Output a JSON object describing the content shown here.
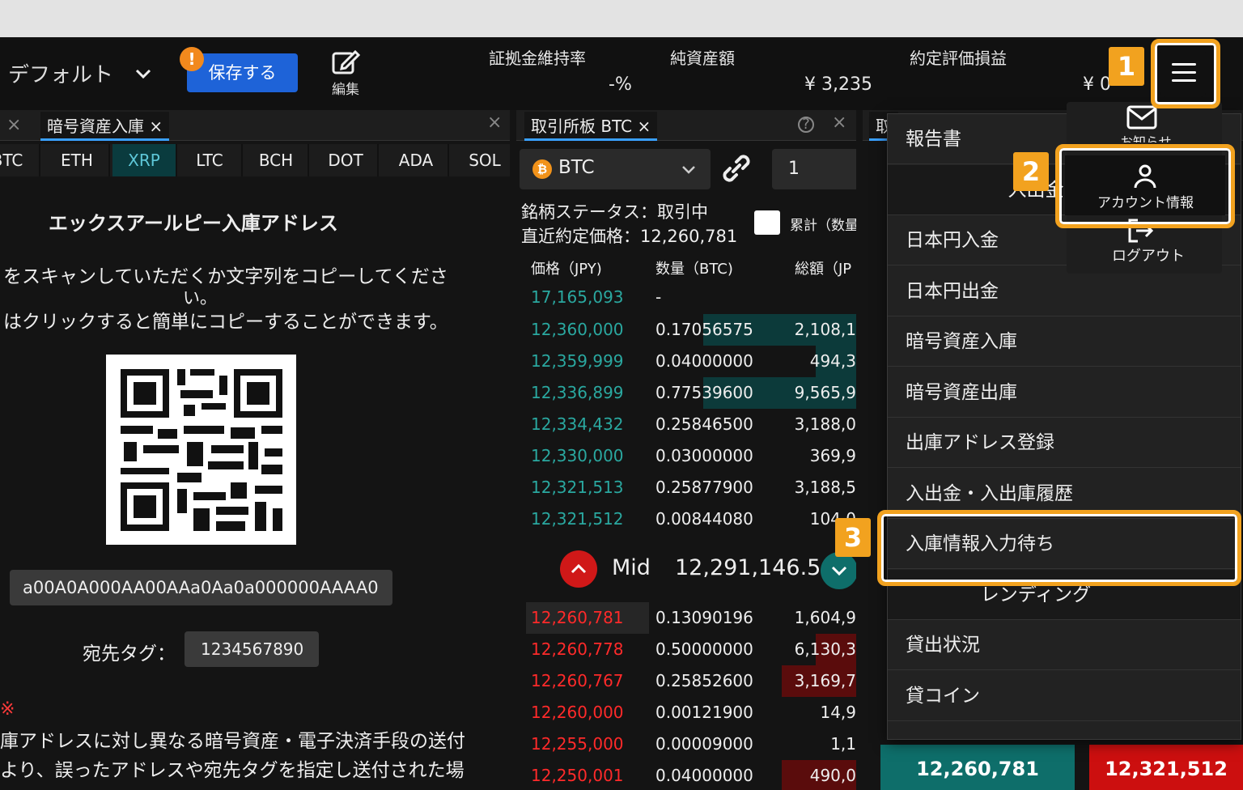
{
  "header": {
    "layout_name": "デフォルト",
    "save_label": "保存する",
    "notice_badge": "!",
    "edit_label": "編集",
    "stats": [
      {
        "label": "証拠金維持率",
        "value": "-%"
      },
      {
        "label": "純資産額",
        "value": "¥ 3,235"
      },
      {
        "label": "約定評価損益",
        "value": "¥ 0"
      }
    ]
  },
  "deposit_panel": {
    "tab_label": "暗号資産入庫",
    "coins": [
      "BTC",
      "ETH",
      "XRP",
      "LTC",
      "BCH",
      "DOT",
      "ADA",
      "SOL"
    ],
    "selected_coin": "XRP",
    "title": "エックスアールピー入庫アドレス",
    "instruction_line1": "をスキャンしていただくか文字列をコピーしてくださ",
    "instruction_line2": "い。",
    "instruction_line3": "はクリックすると簡単にコピーすることができます。",
    "address": "a00A0A000AA00AAa0Aa0a000000AAAA0",
    "tag_label": "宛先タグ：",
    "tag_value": "1234567890",
    "note_mark": "※",
    "note_line1": "庫アドレスに対し異なる暗号資産・電子決済手段の送付",
    "note_line2": "より、誤ったアドレスや宛先タグを指定し送付された場"
  },
  "orderbook_panel": {
    "tab_label": "取引所板 BTC",
    "symbol": "BTC",
    "quantity_value": "1",
    "status_line": "銘柄ステータス：取引中",
    "last_price_line": "直近約定価格：12,260,781",
    "cumulative_label": "累計（数量",
    "col_price": "価格（JPY)",
    "col_qty": "数量（BTC)",
    "col_total": "総額（JP",
    "top_price": "17,165,093",
    "top_qty": "-",
    "asks": [
      {
        "price": "12,360,000",
        "qty": "0.17056575",
        "total": "2,108,1"
      },
      {
        "price": "12,359,999",
        "qty": "0.04000000",
        "total": "494,3"
      },
      {
        "price": "12,336,899",
        "qty": "0.77539600",
        "total": "9,565,9"
      },
      {
        "price": "12,334,432",
        "qty": "0.25846500",
        "total": "3,188,0"
      },
      {
        "price": "12,330,000",
        "qty": "0.03000000",
        "total": "369,9"
      },
      {
        "price": "12,321,513",
        "qty": "0.25877900",
        "total": "3,188,5"
      },
      {
        "price": "12,321,512",
        "qty": "0.00844080",
        "total": "104,0"
      }
    ],
    "mid_label": "Mid",
    "mid_value": "12,291,146.5",
    "bids": [
      {
        "price": "12,260,781",
        "qty": "0.13090196",
        "total": "1,604,9"
      },
      {
        "price": "12,260,778",
        "qty": "0.50000000",
        "total": "6,130,3"
      },
      {
        "price": "12,260,767",
        "qty": "0.25852600",
        "total": "3,169,7"
      },
      {
        "price": "12,260,000",
        "qty": "0.00121900",
        "total": "14,9"
      },
      {
        "price": "12,255,000",
        "qty": "0.00009000",
        "total": "1,1"
      },
      {
        "price": "12,250,001",
        "qty": "0.04000000",
        "total": "490,0"
      }
    ]
  },
  "right_panel": {
    "tab_label": "取",
    "buy_price": "12,260,781",
    "sell_price": "12,321,512"
  },
  "menu": {
    "items": [
      {
        "label": "報告書"
      },
      {
        "label": "入出金",
        "section": true
      },
      {
        "label": "日本円入金"
      },
      {
        "label": "日本円出金"
      },
      {
        "label": "暗号資産入庫"
      },
      {
        "label": "暗号資産出庫"
      },
      {
        "label": "出庫アドレス登録"
      },
      {
        "label": "入出金・入出庫履歴"
      },
      {
        "label": "入庫情報入力待ち"
      },
      {
        "label": "レンディング",
        "section": true
      },
      {
        "label": "貸出状況"
      },
      {
        "label": "貸コイン"
      }
    ]
  },
  "account_popup": {
    "notice_label": "お知らせ",
    "account_label": "アカウント情報",
    "logout_label": "ログアウト"
  },
  "callouts": [
    "1",
    "2",
    "3"
  ],
  "colors": {
    "accent_blue": "#1e63d8",
    "ask_green": "#2aa8a0",
    "bid_red": "#ff2a2a",
    "highlight_orange": "#f2a21f"
  }
}
